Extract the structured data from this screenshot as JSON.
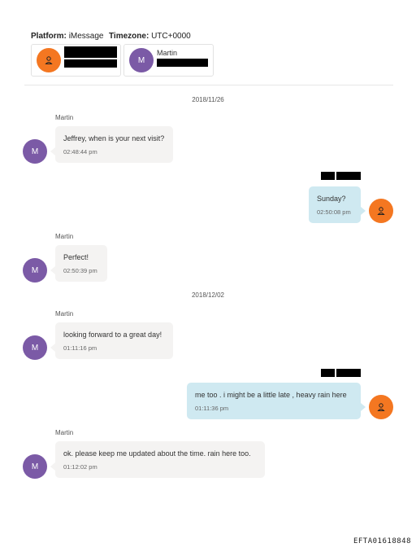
{
  "header": {
    "platform_label": "Platform:",
    "platform_value": "iMessage",
    "timezone_label": "Timezone:",
    "timezone_value": "UTC+0000"
  },
  "participants": [
    {
      "name": "",
      "redacted": true,
      "avatar": "person-icon"
    },
    {
      "name": "Martin",
      "initial": "M",
      "redacted_sub": true
    }
  ],
  "dates": [
    "2018/11/26",
    "2018/12/02"
  ],
  "messages": [
    {
      "sender": "Martin",
      "initial": "M",
      "text": "Jeffrey, when is your next visit?",
      "time": "02:48:44 pm"
    },
    {
      "sender": "",
      "redacted": true,
      "text": "Sunday?",
      "time": "02:50:08 pm"
    },
    {
      "sender": "Martin",
      "initial": "M",
      "text": "Perfect!",
      "time": "02:50:39 pm"
    },
    {
      "sender": "Martin",
      "initial": "M",
      "text": "looking forward to a great day!",
      "time": "01:11:16 pm"
    },
    {
      "sender": "",
      "redacted": true,
      "text": "me too .  i might be a little late , heavy rain here",
      "time": "01:11:36 pm"
    },
    {
      "sender": "Martin",
      "initial": "M",
      "text": "ok. please keep me updated about the time. rain here too.",
      "time": "01:12:02 pm"
    }
  ],
  "footer_id": "EFTA01618848",
  "colors": {
    "martin_avatar": "#7b5aa6",
    "self_avatar": "#f47721",
    "incoming_bubble": "#f4f3f2",
    "outgoing_bubble": "#cfe9f1"
  }
}
